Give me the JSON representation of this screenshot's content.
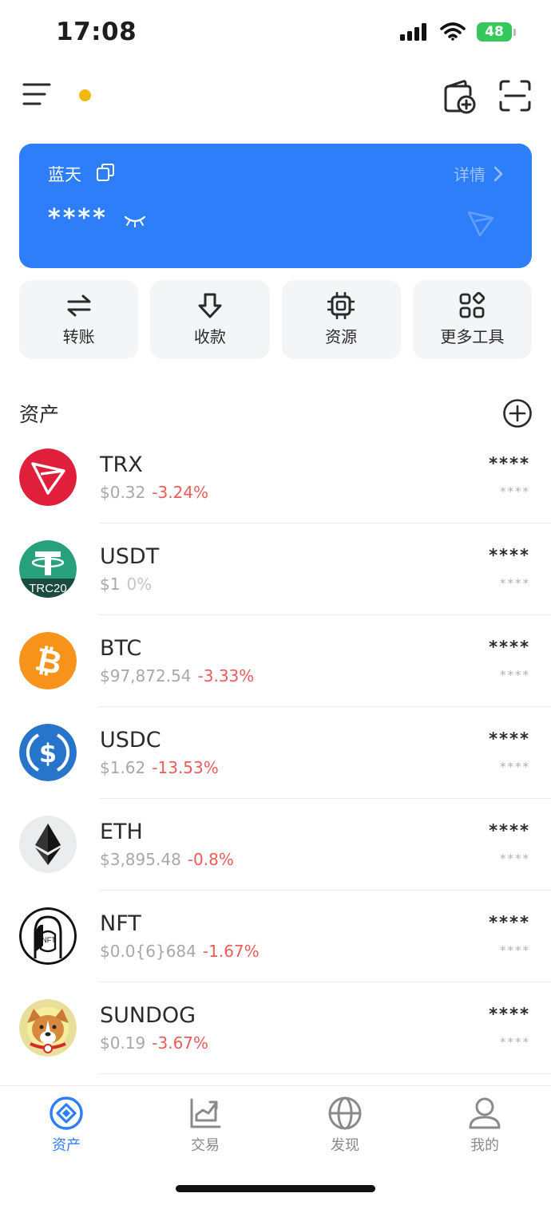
{
  "status_bar": {
    "time": "17:08",
    "battery": "48"
  },
  "wallet": {
    "name": "蓝天",
    "details_label": "详情",
    "balance_masked": "****"
  },
  "actions": [
    {
      "label": "转账",
      "icon": "transfer-icon"
    },
    {
      "label": "收款",
      "icon": "receive-icon"
    },
    {
      "label": "资源",
      "icon": "chip-icon"
    },
    {
      "label": "更多工具",
      "icon": "grid-icon"
    }
  ],
  "assets": {
    "title": "资产",
    "items": [
      {
        "symbol": "TRX",
        "price": "$0.32",
        "change": "-3.24%",
        "amount": "****",
        "value": "****",
        "icon": "trx-icon"
      },
      {
        "symbol": "USDT",
        "price": "$1",
        "change": "0%",
        "amount": "****",
        "value": "****",
        "icon": "usdt-icon",
        "badge": "TRC20"
      },
      {
        "symbol": "BTC",
        "price": "$97,872.54",
        "change": "-3.33%",
        "amount": "****",
        "value": "****",
        "icon": "btc-icon"
      },
      {
        "symbol": "USDC",
        "price": "$1.62",
        "change": "-13.53%",
        "amount": "****",
        "value": "****",
        "icon": "usdc-icon"
      },
      {
        "symbol": "ETH",
        "price": "$3,895.48",
        "change": "-0.8%",
        "amount": "****",
        "value": "****",
        "icon": "eth-icon"
      },
      {
        "symbol": "NFT",
        "price": "$0.0{6}684",
        "change": "-1.67%",
        "amount": "****",
        "value": "****",
        "icon": "nft-icon"
      },
      {
        "symbol": "SUNDOG",
        "price": "$0.19",
        "change": "-3.67%",
        "amount": "****",
        "value": "****",
        "icon": "sundog-icon"
      }
    ]
  },
  "nav": [
    {
      "label": "资产",
      "icon": "assets-icon",
      "active": true
    },
    {
      "label": "交易",
      "icon": "trade-icon",
      "active": false
    },
    {
      "label": "发现",
      "icon": "globe-icon",
      "active": false
    },
    {
      "label": "我的",
      "icon": "profile-icon",
      "active": false
    }
  ],
  "colors": {
    "accent": "#2d7ef8",
    "negative": "#ef5a5a",
    "indicator_dot": "#f0b90b"
  }
}
